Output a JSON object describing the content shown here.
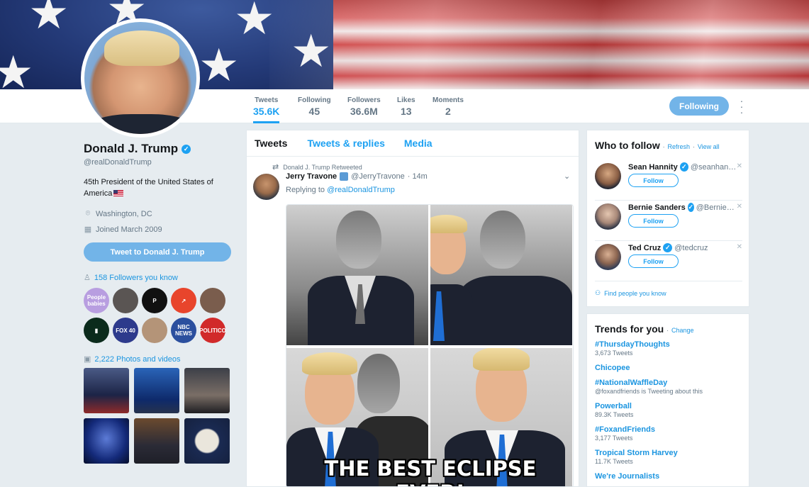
{
  "colors": {
    "accent": "#1da1f2",
    "button_fill": "#72b4e8",
    "muted": "#657786"
  },
  "profile_nav": {
    "stats": [
      {
        "label": "Tweets",
        "value": "35.6K",
        "active": true
      },
      {
        "label": "Following",
        "value": "45"
      },
      {
        "label": "Followers",
        "value": "36.6M"
      },
      {
        "label": "Likes",
        "value": "13"
      },
      {
        "label": "Moments",
        "value": "2"
      }
    ],
    "following_button": "Following",
    "more_icon": "more-vertical-icon"
  },
  "profile": {
    "name": "Donald J. Trump",
    "handle": "@realDonaldTrump",
    "bio": "45th President of the United States of America",
    "location": "Washington, DC",
    "joined": "Joined March 2009",
    "tweet_to_button": "Tweet to Donald J. Trump",
    "followers_you_know": "158 Followers you know",
    "photos_videos": "2,222 Photos and videos",
    "followers_avatars": [
      {
        "label": "People babies",
        "color": "#b89ee0"
      },
      {
        "label": "",
        "color": "#5a5553"
      },
      {
        "label": "P",
        "color": "#111111"
      },
      {
        "label": "↗",
        "color": "#e8452c"
      },
      {
        "label": "",
        "color": "#7a5d4d"
      },
      {
        "label": "▮",
        "color": "#0b2b1c"
      },
      {
        "label": "FOX 40",
        "color": "#2d3a8c"
      },
      {
        "label": "",
        "color": "#b49478"
      },
      {
        "label": "NBC NEWS",
        "color": "#2b4f9e"
      },
      {
        "label": "POLITICO",
        "color": "#d12a2a"
      }
    ]
  },
  "timeline": {
    "tabs": [
      "Tweets",
      "Tweets & replies",
      "Media"
    ],
    "tweet": {
      "retweet_note": "Donald J. Trump Retweeted",
      "author_name": "Jerry Travone",
      "author_handle": "@JerryTravone",
      "time": "· 14m",
      "replying_prefix": "Replying to",
      "replying_handle": "@realDonaldTrump",
      "image_caption": "THE BEST ECLIPSE EVER!"
    }
  },
  "who_to_follow": {
    "title": "Who to follow",
    "refresh": "Refresh",
    "separator": "·",
    "view_all": "View all",
    "follow_label": "Follow",
    "suggestions": [
      {
        "name": "Sean Hannity",
        "handle": "@seanhannity"
      },
      {
        "name": "Bernie Sanders",
        "handle": "@BernieSanders"
      },
      {
        "name": "Ted Cruz",
        "handle": "@tedcruz"
      }
    ],
    "find_people": "Find people you know"
  },
  "trends": {
    "title": "Trends for you",
    "separator": "·",
    "change": "Change",
    "items": [
      {
        "name": "#ThursdayThoughts",
        "sub": "3,673 Tweets"
      },
      {
        "name": "Chicopee",
        "sub": ""
      },
      {
        "name": "#NationalWaffleDay",
        "sub": "@foxandfriends is Tweeting about this"
      },
      {
        "name": "Powerball",
        "sub": "89.3K Tweets"
      },
      {
        "name": "#FoxandFriends",
        "sub": "3,177 Tweets"
      },
      {
        "name": "Tropical Storm Harvey",
        "sub": "11.7K Tweets"
      },
      {
        "name": "We're Journalists",
        "sub": ""
      }
    ]
  }
}
